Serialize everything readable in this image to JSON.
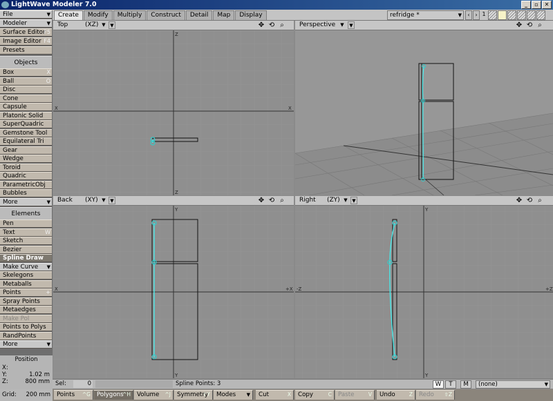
{
  "app": {
    "title": "LightWave Modeler 7.0",
    "min_glyph": "_",
    "max_glyph": "▫",
    "close_glyph": "✕"
  },
  "tabs": [
    "Create",
    "Modify",
    "Multiply",
    "Construct",
    "Detail",
    "Map",
    "Display"
  ],
  "object_select": "refridge *",
  "layer": {
    "prev": "‹",
    "next": "›",
    "number": "1"
  },
  "sidebar": {
    "top": [
      {
        "label": "File",
        "arrow": "▼"
      },
      {
        "label": "Modeler",
        "arrow": "▼"
      },
      {
        "label": "Surface Editor",
        "sc": "F5"
      },
      {
        "label": "Image Editor",
        "sc": "F4"
      },
      {
        "label": "Presets"
      }
    ],
    "objects_header": "Objects",
    "objects": [
      {
        "label": "Box",
        "sc": "X"
      },
      {
        "label": "Ball",
        "sc": "O"
      },
      {
        "label": "Disc"
      },
      {
        "label": "Cone"
      },
      {
        "label": "Capsule"
      },
      {
        "label": "Platonic Solid"
      },
      {
        "label": "SuperQuadric"
      },
      {
        "label": "Gemstone Tool"
      },
      {
        "label": "Equilateral Tri"
      },
      {
        "label": "Gear"
      },
      {
        "label": "Wedge"
      },
      {
        "label": "Toroid"
      },
      {
        "label": "Quadric"
      },
      {
        "label": "ParametricObj"
      },
      {
        "label": "Bubbles"
      },
      {
        "label": "More",
        "arrow": "▼"
      }
    ],
    "elements_header": "Elements",
    "elements": [
      {
        "label": "Pen"
      },
      {
        "label": "Text",
        "sc": "W"
      },
      {
        "label": "Sketch"
      },
      {
        "label": "Bezier"
      },
      {
        "label": "Spline Draw"
      },
      {
        "label": "Make Curve",
        "arrow": "▼"
      },
      {
        "label": "Skelegons"
      },
      {
        "label": "Metaballs"
      },
      {
        "label": "Points",
        "sc": "+"
      },
      {
        "label": "Spray Points"
      },
      {
        "label": "Metaedges"
      },
      {
        "label": "Make Pol"
      },
      {
        "label": "Points to Polys"
      },
      {
        "label": "RandPoints"
      },
      {
        "label": "More",
        "arrow": "▼"
      }
    ]
  },
  "position": {
    "title": "Position",
    "x_label": "X:",
    "x": "",
    "y_label": "Y:",
    "y": "1.02 m",
    "z_label": "Z:",
    "z": "800 mm"
  },
  "viewports": {
    "top": {
      "name": "Top",
      "axes": "(XZ)",
      "axis_top": "Z",
      "axis_bottom": "Z",
      "axis_left": "X",
      "axis_right": "X"
    },
    "persp": {
      "name": "Perspective"
    },
    "back": {
      "name": "Back",
      "axes": "(XY)",
      "axis_top": "Y",
      "axis_bottom": "Y",
      "axis_left": "X",
      "axis_right": "+X"
    },
    "right": {
      "name": "Right",
      "axes": "(ZY)",
      "axis_top": "Y",
      "axis_bottom": "Y",
      "axis_left": "-Z",
      "axis_right": "+Z"
    }
  },
  "status": {
    "sel_label": "Sel:",
    "sel_value": "0",
    "info": "Spline Points: 3",
    "w": "W",
    "t": "T",
    "m": "M",
    "surface": "(none)"
  },
  "bottom": {
    "grid_label": "Grid:",
    "grid_value": "200 mm",
    "buttons": [
      {
        "label": "Points",
        "sc": "^G"
      },
      {
        "label": "Polygons",
        "sc": "^H"
      },
      {
        "label": "Volume",
        "sc": "^J"
      },
      {
        "label": "Symmetry",
        "sc": "⇧Y"
      },
      {
        "label": "Modes",
        "arrow": "▼"
      },
      {
        "label": "Cut",
        "sc": "X"
      },
      {
        "label": "Copy",
        "sc": "C"
      },
      {
        "label": "Paste",
        "sc": "V"
      },
      {
        "label": "Undo",
        "sc": "Z"
      },
      {
        "label": "Redo",
        "sc": "⇧Z"
      }
    ]
  }
}
